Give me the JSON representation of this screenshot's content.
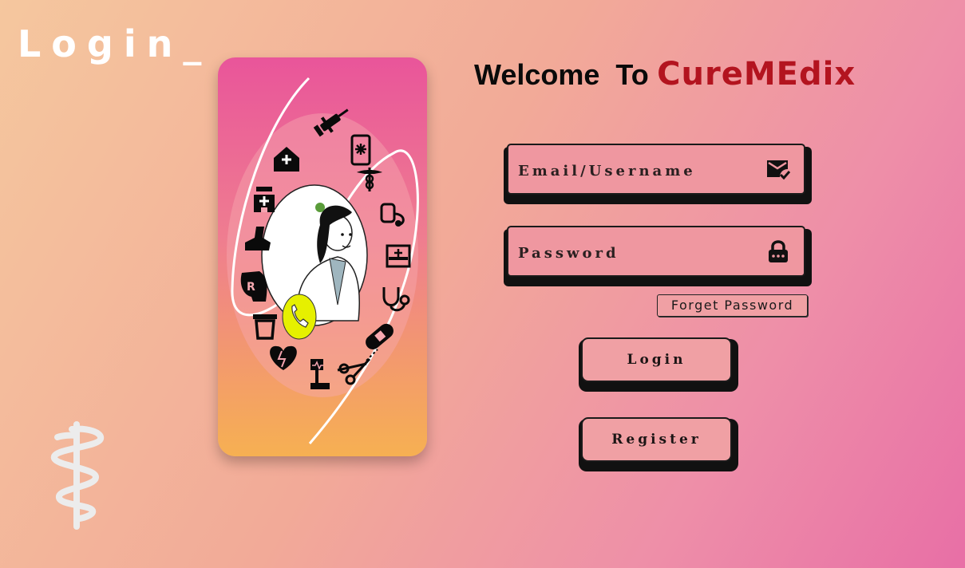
{
  "page": {
    "title": "Login_"
  },
  "welcome": {
    "prefix": "Welcome  To",
    "brand": "CureMEdix",
    "brand_color": "#b3141f"
  },
  "form": {
    "email": {
      "placeholder": "Email/Username",
      "icon": "mail-check-icon"
    },
    "password": {
      "placeholder": "Password",
      "icon": "lock-icon"
    },
    "forgot_label": "Forget Password",
    "login_label": "Login",
    "register_label": "Register"
  },
  "illustration": {
    "icons": [
      "syringe-icon",
      "smartphone-medical-icon",
      "hospital-home-icon",
      "caduceus-small-icon",
      "hospital-building-icon",
      "blood-pressure-icon",
      "foot-icon",
      "hospital-bed-icon",
      "rx-head-icon",
      "stethoscope-icon",
      "phone-call-icon",
      "pill-bottle-icon",
      "bandage-icon",
      "heart-pulse-icon",
      "scissors-icon",
      "ecg-stand-icon"
    ],
    "accent": "#e6f000"
  },
  "colors": {
    "card_top": "#e9559a",
    "card_bottom": "#f6b052",
    "field_bg": "#ef97a0"
  }
}
